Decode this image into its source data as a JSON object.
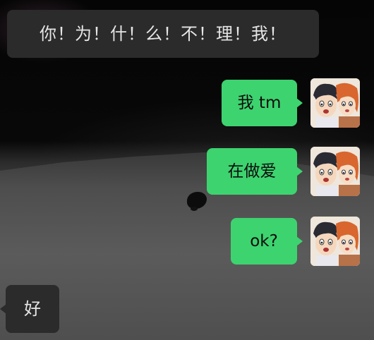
{
  "messages": [
    {
      "side": "left",
      "text": "你！为！什！么！不！理！我！"
    },
    {
      "side": "right",
      "text": "我 tm"
    },
    {
      "side": "right",
      "text": "在做爱"
    },
    {
      "side": "right",
      "text": "ok?"
    },
    {
      "side": "left",
      "text": "好"
    }
  ],
  "avatar": {
    "icon": "anime-duo-avatar-icon"
  },
  "colors": {
    "bubble_right": "#3dd36f",
    "bubble_left": "#2b2b2b",
    "text_left": "#e6e6e6"
  }
}
